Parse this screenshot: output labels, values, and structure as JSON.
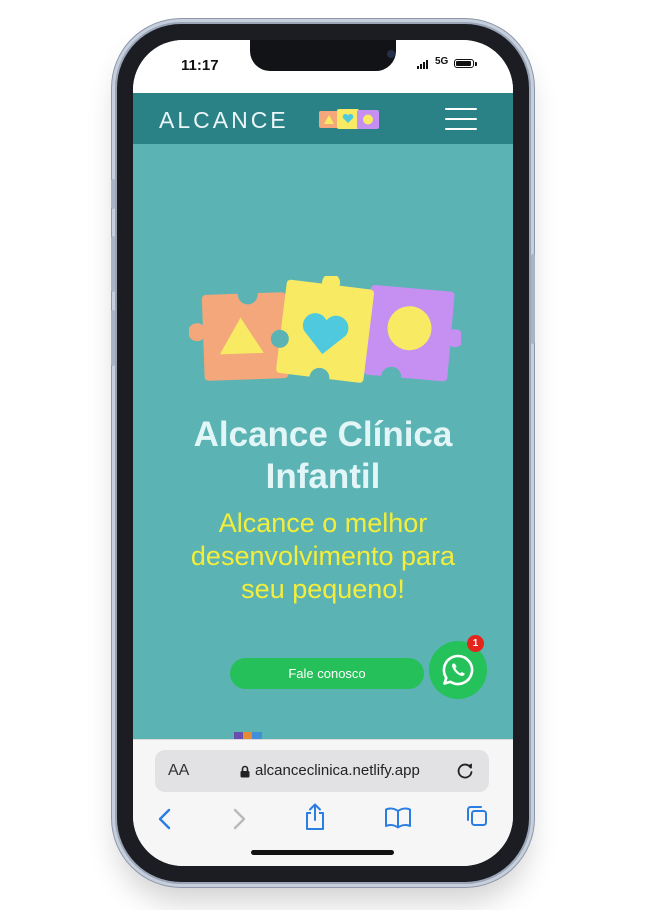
{
  "status_bar": {
    "time": "11:17",
    "network": "5G"
  },
  "site": {
    "brand": "ALCANCE",
    "menu_icon": "hamburger-menu-icon",
    "logo_icon": "puzzle-pieces-logo",
    "hero": {
      "title_line1": "Alcance Clínica",
      "title_line2": "Infantil",
      "subtitle_line1": "Alcance o melhor",
      "subtitle_line2": "desenvolvimento para",
      "subtitle_line3": "seu pequeno!",
      "cta_label": "Fale conosco",
      "whatsapp_badge": "1"
    },
    "colors": {
      "navbar": "#2a8287",
      "hero_bg": "#5bb3b4",
      "title": "#e2f6f8",
      "subtitle": "#f4ee3a",
      "cta": "#26c05a",
      "puzzle_orange": "#f3a77b",
      "puzzle_yellow": "#f8ea63",
      "puzzle_purple": "#c68ff2"
    }
  },
  "browser": {
    "text_size_label": "AA",
    "url": "alcanceclinica.netlify.app",
    "toolbar": [
      "back-icon",
      "forward-icon",
      "share-icon",
      "bookmarks-icon",
      "tabs-icon"
    ]
  }
}
